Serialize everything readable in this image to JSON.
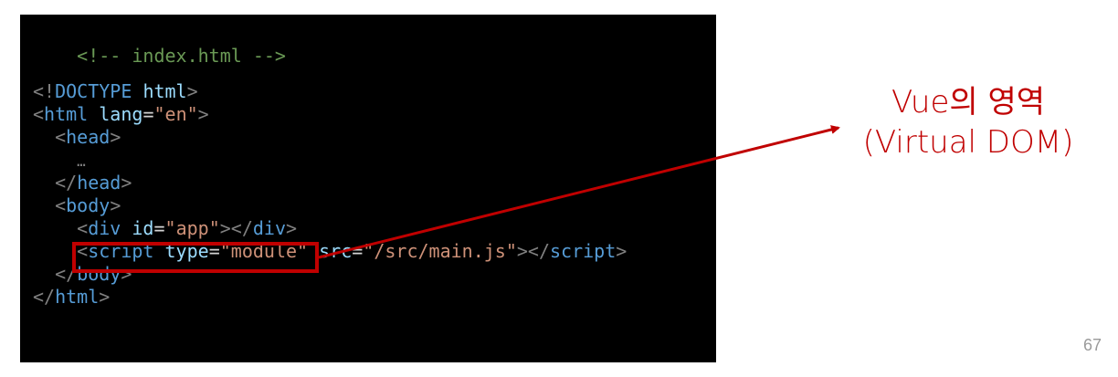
{
  "code": {
    "comment": "<!-- index.html -->",
    "doctype": "<!DOCTYPE html>",
    "ellipsis": "…",
    "lang_value": "\"en\"",
    "app_id_value": "\"app\"",
    "script_type_value": "\"module\"",
    "script_src_value": "\"/src/main.js\""
  },
  "callout": {
    "line1": "Vue의 영역",
    "line2": "(Virtual DOM)"
  },
  "page_number": "67",
  "colors": {
    "accent": "#c00000",
    "code_background": "#000000"
  }
}
